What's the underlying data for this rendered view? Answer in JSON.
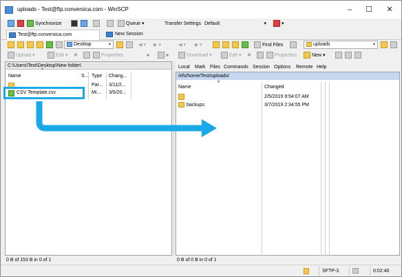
{
  "window": {
    "title": "uploads - Test@ftp.conversica.com - WinSCP",
    "controls": [
      "–",
      "☐",
      "✕"
    ]
  },
  "toolbar1": {
    "synchronize": "Synchronize",
    "queue": "Queue",
    "transfer_settings_label": "Transfer Settings",
    "transfer_settings_value": "Default"
  },
  "tabs": [
    {
      "label": "Test@ftp.conversica.com"
    },
    {
      "label": "New Session"
    }
  ],
  "left_nav": {
    "location": "Desktop"
  },
  "right_nav": {
    "find_files": "Find Files",
    "location": "uploads"
  },
  "left_cmd": {
    "upload": "Upload",
    "edit": "Edit",
    "properties": "Properties"
  },
  "right_cmd": {
    "download": "Download",
    "edit": "Edit",
    "properties": "Properties",
    "new": "New"
  },
  "right_menu": [
    "Local",
    "Mark",
    "Files",
    "Commands",
    "Session",
    "Options",
    "Remote",
    "Help"
  ],
  "left_panel": {
    "path": "C:\\Users\\Test\\Desktop\\New folder\\",
    "columns": [
      "Name",
      "S...",
      "Type",
      "Chang..."
    ],
    "rows": [
      {
        "name": "..",
        "size": "",
        "type": "Par...",
        "changed": "3/11/2..."
      },
      {
        "name": "CSV Template.csv",
        "size": "1",
        "type": "Mi...",
        "changed": "3/5/20..."
      }
    ],
    "status": "0 B of 153 B in 0 of 1"
  },
  "right_panel": {
    "path": "/efs/home/Test/uploads/",
    "columns": [
      "Name",
      "Changed"
    ],
    "rows": [
      {
        "name": "..",
        "changed": "2/5/2019 9:54:07 AM"
      },
      {
        "name": "backups",
        "changed": "3/7/2019 2:34:55 PM"
      }
    ],
    "status": "0 B of 0 B in 0 of 1"
  },
  "bottom": {
    "protocol": "SFTP-3",
    "time": "0:02:40"
  },
  "colors": {
    "annotation": "#1aa8e8",
    "remote_path_bg": "#c6d8ef"
  }
}
